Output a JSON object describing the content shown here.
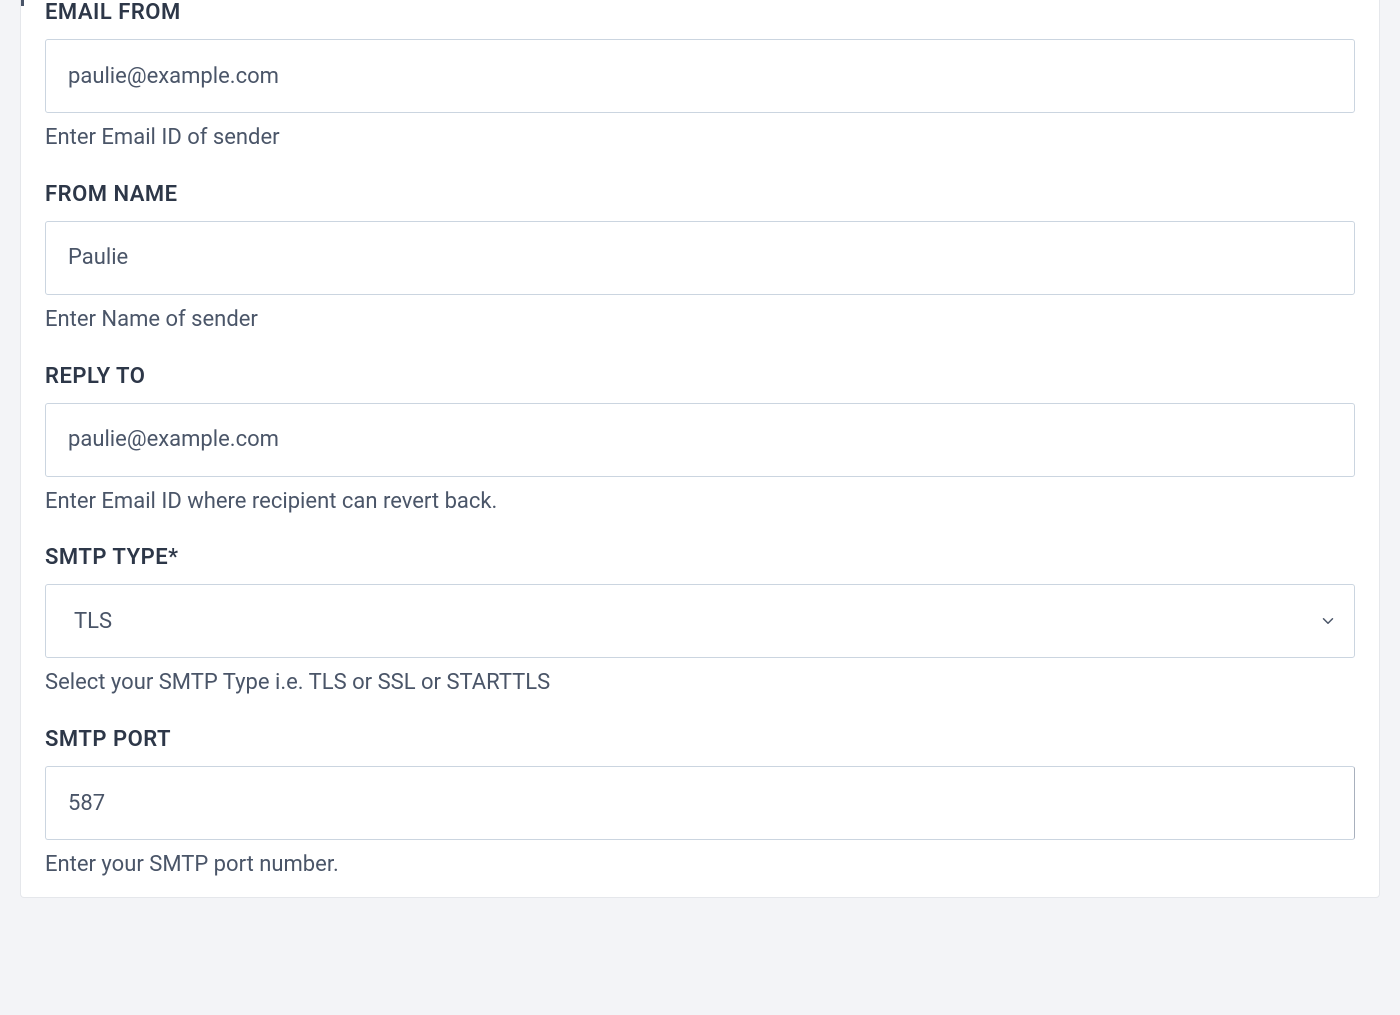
{
  "form": {
    "email_from": {
      "label": "EMAIL FROM",
      "value": "paulie@example.com",
      "help": "Enter Email ID of sender"
    },
    "from_name": {
      "label": "FROM NAME",
      "value": "Paulie",
      "help": "Enter Name of sender"
    },
    "reply_to": {
      "label": "REPLY TO",
      "value": "paulie@example.com",
      "help": "Enter Email ID where recipient can revert back."
    },
    "smtp_type": {
      "label": "SMTP TYPE*",
      "selected": "TLS",
      "help": "Select your SMTP Type i.e. TLS or SSL or STARTTLS"
    },
    "smtp_port": {
      "label": "SMTP PORT",
      "value": "587",
      "help": "Enter your SMTP port number."
    }
  }
}
